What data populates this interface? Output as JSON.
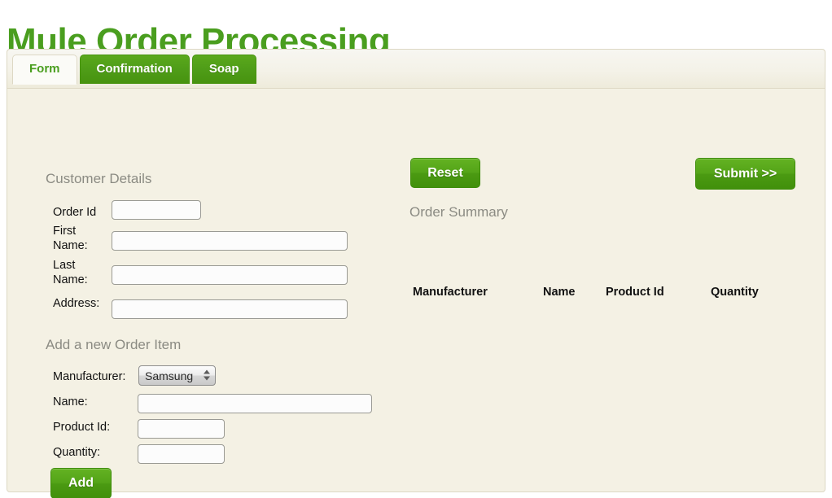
{
  "page": {
    "title": "Mule Order Processing",
    "title_color": "#4a9e1f"
  },
  "tabs": [
    {
      "label": "Form",
      "active": true
    },
    {
      "label": "Confirmation",
      "active": false
    },
    {
      "label": "Soap",
      "active": false
    }
  ],
  "form": {
    "customer_section_heading": "Customer Details",
    "fields": {
      "order_id_label": "Order Id",
      "order_id_value": "",
      "order_id_placeholder": "",
      "first_name_label": "First Name:",
      "first_name_value": "",
      "first_name_placeholder": "",
      "last_name_label": "Last Name:",
      "last_name_value": "",
      "last_name_placeholder": "",
      "address_label": "Address:",
      "address_value": "",
      "address_placeholder": ""
    },
    "order_item_section_heading": "Add a new Order Item",
    "item_fields": {
      "manufacturer_label": "Manufacturer:",
      "manufacturer_selected": "Samsung",
      "manufacturer_options": [
        "Samsung"
      ],
      "name_label": "Name:",
      "name_value": "",
      "name_placeholder": "",
      "product_id_label": "Product Id:",
      "product_id_value": "",
      "product_id_placeholder": "",
      "quantity_label": "Quantity:",
      "quantity_value": "",
      "quantity_placeholder": ""
    },
    "add_button_label": "Add"
  },
  "actions": {
    "reset_label": "Reset",
    "submit_label": "Submit >>"
  },
  "summary": {
    "heading": "Order Summary",
    "columns": [
      "Manufacturer",
      "Name",
      "Product Id",
      "Quantity"
    ],
    "rows": []
  },
  "colors": {
    "brand_green": "#4a9e1f",
    "button_green_top": "#63b222",
    "button_green_bottom": "#41900b",
    "panel_cream": "#f4f1e4",
    "heading_gray": "#8b8b83"
  }
}
